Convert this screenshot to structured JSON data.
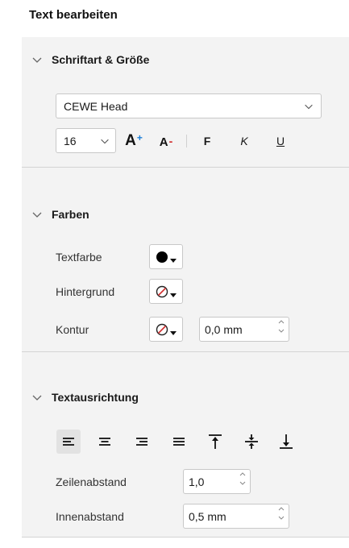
{
  "title": "Text bearbeiten",
  "font_section": {
    "label": "Schriftart & Größe",
    "font_value": "CEWE Head",
    "size_value": "16",
    "grow_label": "A",
    "grow_mark": "+",
    "shrink_label": "A",
    "shrink_mark": "-",
    "bold_label": "F",
    "italic_label": "K",
    "underline_label": "U"
  },
  "color_section": {
    "label": "Farben",
    "text_color_label": "Textfarbe",
    "background_label": "Hintergrund",
    "outline_label": "Kontur",
    "outline_width": "0,0 mm",
    "text_color": "#000000",
    "none_color": "#d22e2e"
  },
  "align_section": {
    "label": "Textausrichtung",
    "line_spacing_label": "Zeilenabstand",
    "line_spacing_value": "1,0",
    "padding_label": "Innenabstand",
    "padding_value": "0,5 mm"
  },
  "icons": [
    "chevron-down-icon",
    "align-left-icon",
    "align-center-icon",
    "align-right-icon",
    "justify-icon",
    "valign-top-icon",
    "valign-middle-icon",
    "valign-bottom-icon",
    "no-color-icon",
    "dropdown-triangle-icon",
    "spin-up-icon",
    "spin-down-icon"
  ]
}
